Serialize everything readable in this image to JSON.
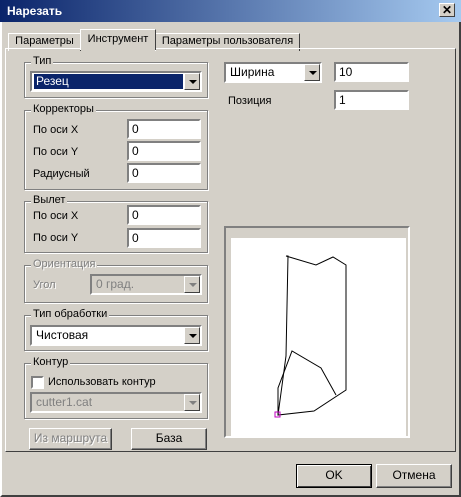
{
  "window": {
    "title": "Нарезать",
    "close_glyph": "✕"
  },
  "tabs": [
    {
      "label": "Параметры"
    },
    {
      "label": "Инструмент"
    },
    {
      "label": "Параметры пользователя"
    }
  ],
  "type_group": {
    "legend": "Тип",
    "selected": "Резец"
  },
  "correctors": {
    "legend": "Корректоры",
    "x_label": "По оси X",
    "x_value": "0",
    "y_label": "По оси Y",
    "y_value": "0",
    "radial_label": "Радиусный",
    "radial_value": "0"
  },
  "overhang": {
    "legend": "Вылет",
    "x_label": "По оси X",
    "x_value": "0",
    "y_label": "По оси Y",
    "y_value": "0"
  },
  "orientation": {
    "legend": "Ориентация",
    "angle_label": "Угол",
    "angle_value": "0 град."
  },
  "processing": {
    "legend": "Тип обработки",
    "selected": "Чистовая"
  },
  "contour": {
    "legend": "Контур",
    "use_label": "Использовать контур",
    "file": "cutter1.cat"
  },
  "buttons": {
    "from_route": "Из маршрута",
    "base": "База",
    "ok": "OK",
    "cancel": "Отмена"
  },
  "params": {
    "width_label": "Ширина",
    "width_value": "10",
    "position_label": "Позиция",
    "position_value": "1"
  }
}
